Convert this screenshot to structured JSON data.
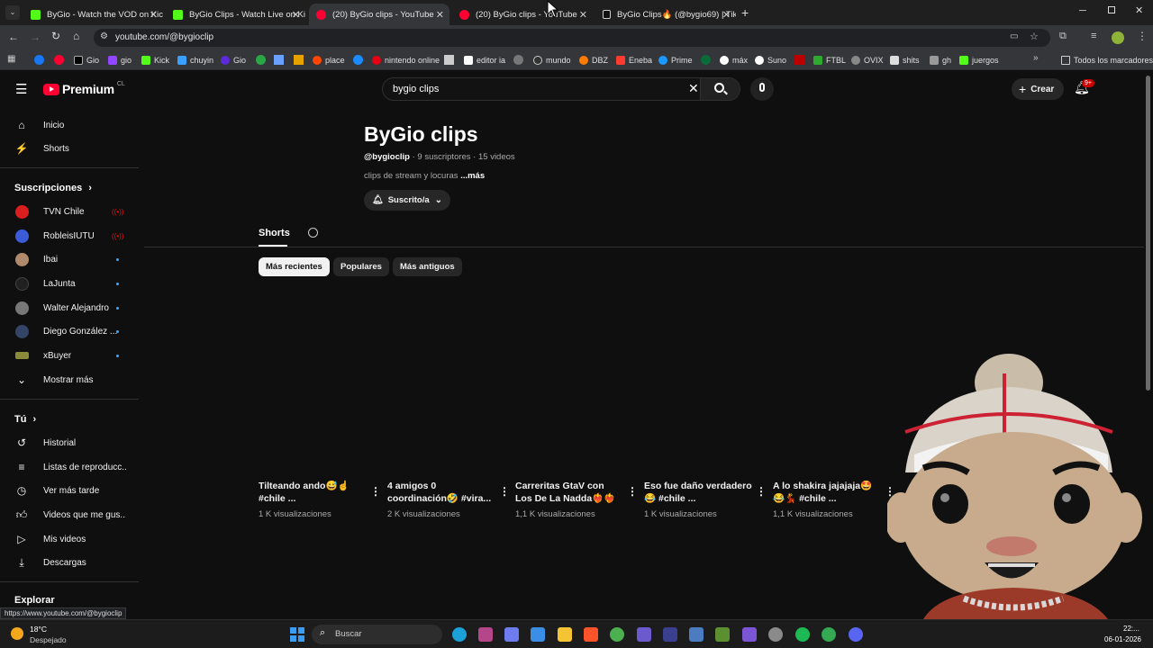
{
  "browser": {
    "tabs": [
      {
        "title": "ByGio - Watch the VOD on Kick",
        "color": "#53fc18"
      },
      {
        "title": "ByGio Clips - Watch Live on Kick",
        "color": "#53fc18"
      },
      {
        "title": "(20) ByGio clips - YouTube",
        "color": "#ff0033"
      },
      {
        "title": "(20) ByGio clips - YouTube",
        "color": "#ff0033"
      },
      {
        "title": "ByGio Clips🔥 (@bygio69) | Tik",
        "color": "#ffffff"
      }
    ],
    "url": "youtube.com/@bygioclip",
    "bookmarks": [
      "Gio",
      "gio",
      "Kick",
      "chuyin",
      "Gio",
      "place",
      "nintendo online",
      "editor ia",
      "mundo",
      "DBZ",
      "Eneba",
      "Prime",
      "máx",
      "Suno",
      "FTBL",
      "OVIX",
      "shits",
      "gh",
      "juergos"
    ],
    "bookmarks_folder": "Todos los marcadores"
  },
  "youtube": {
    "logo": "Premium",
    "logo_region": "CL",
    "search_query": "bygio clips",
    "create_label": "Crear",
    "notif_count": "9+"
  },
  "sidebar": {
    "main": [
      {
        "label": "Inicio"
      },
      {
        "label": "Shorts"
      }
    ],
    "subscriptions_title": "Suscripciones",
    "subscriptions": [
      {
        "label": "TVN Chile",
        "color": "#d81e1e",
        "status": "live"
      },
      {
        "label": "RobleisIUTU",
        "color": "#3b5bd9",
        "status": "live"
      },
      {
        "label": "Ibai",
        "color": "#b08a6a",
        "status": "new"
      },
      {
        "label": "LaJunta",
        "color": "#202020",
        "status": "new"
      },
      {
        "label": "Walter Alejandro",
        "color": "#777777",
        "status": "new"
      },
      {
        "label": "Diego González ...",
        "color": "#334466",
        "status": "new"
      },
      {
        "label": "xBuyer",
        "color": "#8a8a3a",
        "status": "new"
      }
    ],
    "show_more": "Mostrar más",
    "you_title": "Tú",
    "you_items": [
      {
        "label": "Historial"
      },
      {
        "label": "Listas de reproducc..."
      },
      {
        "label": "Ver más tarde"
      },
      {
        "label": "Videos que me gus..."
      },
      {
        "label": "Mis videos"
      },
      {
        "label": "Descargas"
      }
    ],
    "explore_title": "Explorar"
  },
  "channel": {
    "name": "ByGio clips",
    "handle": "@bygioclip",
    "subs": "· 9 suscriptores · 15 videos",
    "description": "clips de stream y locuras",
    "more": "...más",
    "subscribed_label": "Suscrito/a",
    "tab": "Shorts"
  },
  "chips": [
    "Más recientes",
    "Populares",
    "Más antiguos"
  ],
  "shorts": [
    {
      "title": "Tilteando ando😅☝️ #chile ...",
      "views": "1 K visualizaciones"
    },
    {
      "title": "4 amigos 0 coordinación🤣 #vira...",
      "views": "2 K visualizaciones"
    },
    {
      "title": "Carreritas GtaV con Los De La Nadda❤️‍🔥❤️‍🔥 ...",
      "views": "1,1 K visualizaciones"
    },
    {
      "title": "Eso fue daño verdadero😂 #chile ...",
      "views": "1 K visualizaciones"
    },
    {
      "title": "A lo shakira jajajaja🤩😂💃 #chile ...",
      "views": "1,1 K visualizaciones"
    }
  ],
  "status_url": "https://www.youtube.com/@bygioclip",
  "taskbar": {
    "temp": "18°C",
    "weather": "Despejado",
    "search_label": "Buscar",
    "time": "22:...",
    "date": "06-01-2026"
  }
}
